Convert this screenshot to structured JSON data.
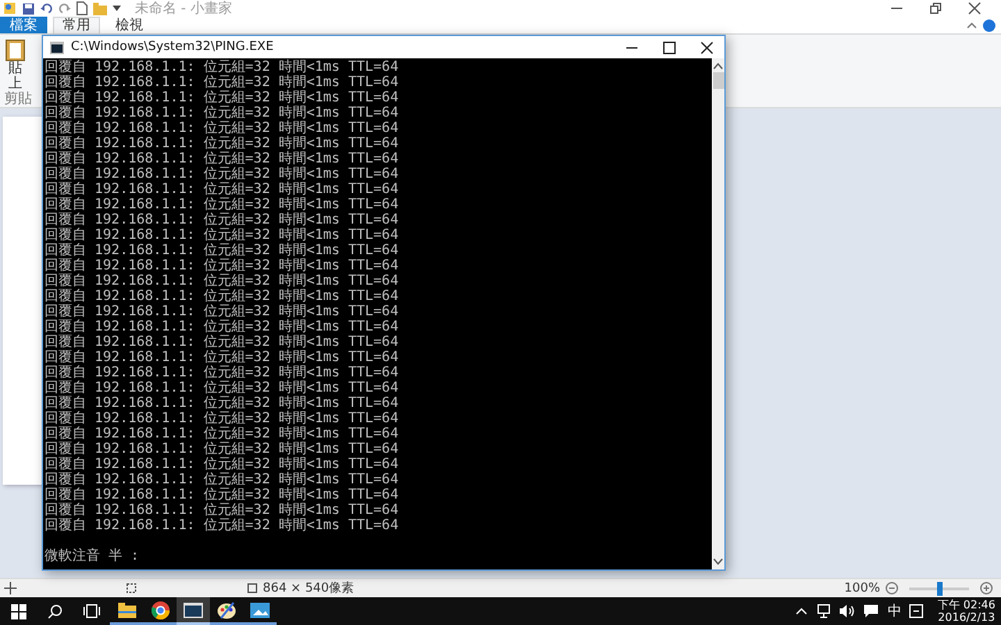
{
  "paint": {
    "title": "未命名 - 小畫家",
    "tabs": [
      {
        "label": "檔案",
        "kind": "file",
        "selected": false
      },
      {
        "label": "常用",
        "kind": "tab",
        "selected": true
      },
      {
        "label": "檢視",
        "kind": "tab",
        "selected": false
      }
    ],
    "paste_label": "貼上",
    "group_label": "剪貼",
    "status_bar": {
      "size": "864 × 540像素",
      "zoom": "100%",
      "level": 0.5
    }
  },
  "console": {
    "title": "C:\\Windows\\System32\\PING.EXE",
    "lines": [
      "回覆自 192.168.1.1: 位元組=32 時間<1ms TTL=64",
      "回覆自 192.168.1.1: 位元組=32 時間<1ms TTL=64",
      "回覆自 192.168.1.1: 位元組=32 時間<1ms TTL=64",
      "回覆自 192.168.1.1: 位元組=32 時間<1ms TTL=64",
      "回覆自 192.168.1.1: 位元組=32 時間<1ms TTL=64",
      "回覆自 192.168.1.1: 位元組=32 時間<1ms TTL=64",
      "回覆自 192.168.1.1: 位元組=32 時間<1ms TTL=64",
      "回覆自 192.168.1.1: 位元組=32 時間<1ms TTL=64",
      "回覆自 192.168.1.1: 位元組=32 時間<1ms TTL=64",
      "回覆自 192.168.1.1: 位元組=32 時間<1ms TTL=64",
      "回覆自 192.168.1.1: 位元組=32 時間<1ms TTL=64",
      "回覆自 192.168.1.1: 位元組=32 時間<1ms TTL=64",
      "回覆自 192.168.1.1: 位元組=32 時間<1ms TTL=64",
      "回覆自 192.168.1.1: 位元組=32 時間<1ms TTL=64",
      "回覆自 192.168.1.1: 位元組=32 時間<1ms TTL=64",
      "回覆自 192.168.1.1: 位元組=32 時間<1ms TTL=64",
      "回覆自 192.168.1.1: 位元組=32 時間<1ms TTL=64",
      "回覆自 192.168.1.1: 位元組=32 時間<1ms TTL=64",
      "回覆自 192.168.1.1: 位元組=32 時間<1ms TTL=64",
      "回覆自 192.168.1.1: 位元組=32 時間<1ms TTL=64",
      "回覆自 192.168.1.1: 位元組=32 時間<1ms TTL=64",
      "回覆自 192.168.1.1: 位元組=32 時間<1ms TTL=64",
      "回覆自 192.168.1.1: 位元組=32 時間<1ms TTL=64",
      "回覆自 192.168.1.1: 位元組=32 時間<1ms TTL=64",
      "回覆自 192.168.1.1: 位元組=32 時間<1ms TTL=64",
      "回覆自 192.168.1.1: 位元組=32 時間<1ms TTL=64",
      "回覆自 192.168.1.1: 位元組=32 時間<1ms TTL=64",
      "回覆自 192.168.1.1: 位元組=32 時間<1ms TTL=64",
      "回覆自 192.168.1.1: 位元組=32 時間<1ms TTL=64",
      "回覆自 192.168.1.1: 位元組=32 時間<1ms TTL=64",
      "回覆自 192.168.1.1: 位元組=32 時間<1ms TTL=64"
    ],
    "prompt": "微軟注音 半 :"
  },
  "taskbar": {
    "apps": [
      {
        "kind": "folder",
        "active": false
      },
      {
        "kind": "chrome",
        "active": false
      },
      {
        "kind": "console",
        "active": true
      },
      {
        "kind": "paint",
        "active": false
      },
      {
        "kind": "picture",
        "active": false
      }
    ],
    "ime": "中",
    "time": "下午 02:46",
    "date": "2016/2/13"
  }
}
